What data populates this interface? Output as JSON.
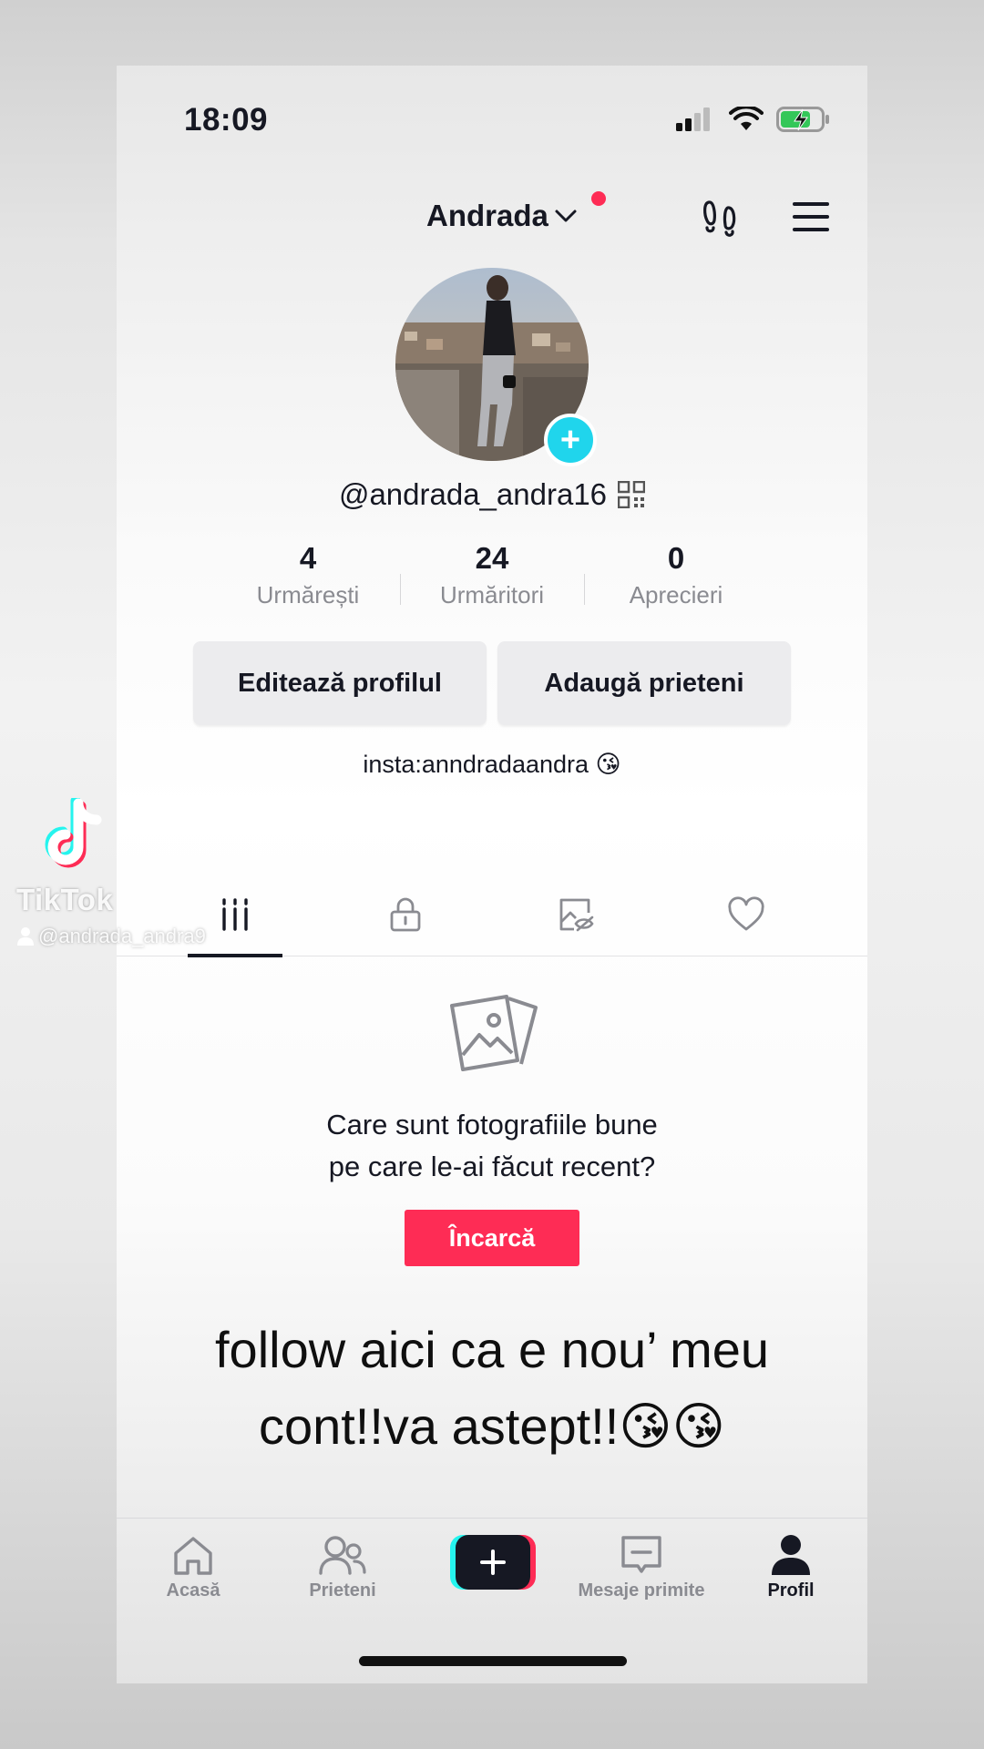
{
  "status_bar": {
    "time": "18:09"
  },
  "header": {
    "account_name": "Andrada"
  },
  "profile": {
    "username": "@andrada_andra16",
    "bio": "insta:anndradaandra 😘"
  },
  "stats": [
    {
      "value": "4",
      "label": "Urmărești"
    },
    {
      "value": "24",
      "label": "Urmăritori"
    },
    {
      "value": "0",
      "label": "Aprecieri"
    }
  ],
  "buttons": {
    "edit_profile": "Editează profilul",
    "add_friends": "Adaugă prieteni"
  },
  "tabs": [
    {
      "icon": "grid-videos-icon",
      "active": true
    },
    {
      "icon": "lock-private-icon",
      "active": false
    },
    {
      "icon": "hidden-posts-icon",
      "active": false
    },
    {
      "icon": "heart-liked-icon",
      "active": false
    }
  ],
  "empty_state": {
    "line1": "Care sunt fotografiile bune",
    "line2": "pe care le-ai făcut recent?",
    "upload_label": "Încarcă"
  },
  "overlay_caption": {
    "line1": "follow aici ca e nou’ meu",
    "line2": "cont!!va astept!!😘😘"
  },
  "bottom_nav": [
    {
      "label": "Acasă",
      "icon": "home-icon"
    },
    {
      "label": "Prieteni",
      "icon": "friends-icon"
    },
    {
      "label": "",
      "icon": "create-plus-icon"
    },
    {
      "label": "Mesaje primite",
      "icon": "inbox-icon"
    },
    {
      "label": "Profil",
      "icon": "profile-icon"
    }
  ],
  "watermark": {
    "brand": "TikTok",
    "user": "@andrada_andra9"
  },
  "colors": {
    "accent": "#fe2c55",
    "cyan": "#20d5ec",
    "text": "#161823",
    "muted": "#8a8b91"
  }
}
